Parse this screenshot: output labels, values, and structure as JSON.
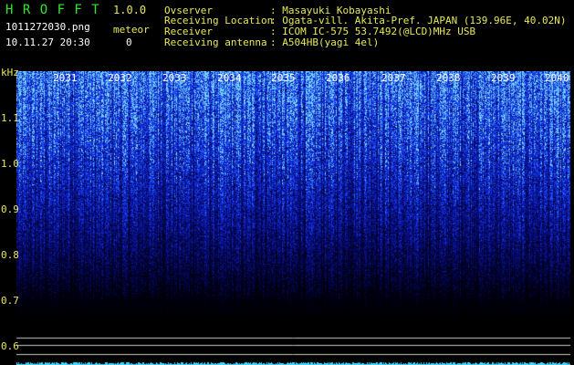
{
  "header": {
    "app_title": "H R O F F T",
    "version": "1.0.0",
    "filename": "1011272030.png",
    "datetime": "10.11.27 20:30",
    "meteor_label": "meteor",
    "meteor_count": "0"
  },
  "info": {
    "rows": [
      {
        "label": "Ovserver",
        "value": ": Masayuki Kobayashi"
      },
      {
        "label": "Receiving Location",
        "value": ": Ogata-vill. Akita-Pref. JAPAN (139.96E, 40.02N)"
      },
      {
        "label": "Receiver",
        "value": ": ICOM IC-575 53.7492(@LCD)MHz USB"
      },
      {
        "label": "Receiving antenna",
        "value": ": A504HB(yagi 4el)"
      }
    ]
  },
  "plot": {
    "y_unit": "kHz",
    "y_ticks": [
      "1.1",
      "1.0",
      "0.9",
      "0.8",
      "0.7",
      "0.6"
    ],
    "x_ticks": [
      "2031",
      "2032",
      "2033",
      "2034",
      "2035",
      "2036",
      "2037",
      "2038",
      "2039",
      "2040"
    ],
    "colors": {
      "bright": "#9ad8ff",
      "mid": "#2a4bff",
      "dark": "#0a0a60",
      "line": "#c8c8c8",
      "cyan": "#3fd8ff"
    }
  }
}
